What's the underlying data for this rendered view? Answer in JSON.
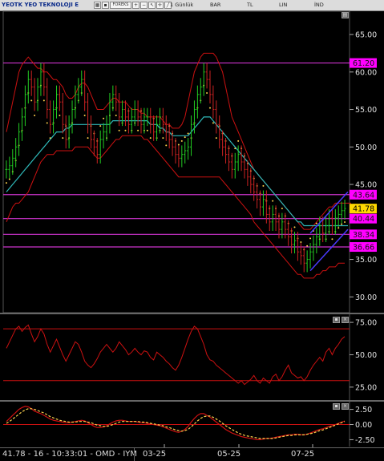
{
  "toolbar": {
    "symbol_title": "YEOTK YEO TEKNOLOJI E",
    "forex_label": "FOREKS",
    "period": "1 Günlük",
    "chart_type": "BAR",
    "currency": "TL",
    "scale": "LIN",
    "indicator_menu": "İND"
  },
  "status": {
    "info": "41.78 - 16 - 10:33:01 - OMD - IYM",
    "dates": [
      "03-25",
      "05-25",
      "07-25"
    ]
  },
  "colors": {
    "bollinger": "#cc1111",
    "ma": "#2fb8b8",
    "sar": "#ffd24d",
    "level": "#cc33cc",
    "up_bar": "#22cc22",
    "down_bar": "#cc2222",
    "rsi": "#cc1111",
    "macd": "#cc1111",
    "signal": "#ffd24d"
  },
  "chart_data": [
    {
      "type": "line",
      "panel": "price",
      "yticks": [
        "65.00",
        "60.00",
        "55.00",
        "50.00",
        "45.00",
        "35.00",
        "30.00"
      ],
      "ylim": [
        28,
        68
      ],
      "levels": [
        {
          "value": 61.2,
          "label": "61.20",
          "color": "#cc33cc"
        },
        {
          "value": 43.64,
          "label": "43.64",
          "color": "#cc33cc"
        },
        {
          "value": 40.44,
          "label": "40.44",
          "color": "#cc33cc"
        },
        {
          "value": 36.66,
          "label": "36.66",
          "color": "#cc33cc"
        },
        {
          "value": 38.34,
          "label": "38.34",
          "color": "#cc33cc"
        }
      ],
      "last_price": {
        "value": 41.78,
        "label": "41.78"
      },
      "closes": [
        47,
        47.5,
        48.5,
        50,
        52,
        54,
        57,
        59,
        58,
        56,
        58,
        60,
        58,
        55,
        53,
        55,
        57,
        56,
        53,
        51,
        53,
        55,
        57,
        58,
        59,
        56,
        53,
        51,
        50,
        49,
        51,
        52,
        53,
        56,
        57,
        56,
        54,
        55,
        54,
        53,
        54,
        55,
        54,
        53,
        54,
        54,
        53,
        52,
        53,
        54,
        53,
        52,
        51,
        50,
        49,
        48.5,
        49,
        49.5,
        50,
        53,
        55,
        57,
        58,
        60,
        59,
        57,
        55,
        53,
        51,
        50,
        49,
        48,
        47,
        48,
        49,
        48,
        47,
        46,
        45,
        44,
        43,
        42,
        43,
        41,
        40,
        41,
        40,
        39,
        40,
        39,
        38,
        37,
        37.5,
        36,
        35.5,
        34.5,
        35,
        36,
        37,
        38,
        39.5,
        38.5,
        39.5,
        40.5,
        39.5,
        40.5,
        41,
        41.5,
        41.78
      ],
      "upper_band": [
        52,
        54,
        56,
        58,
        60,
        61,
        61.5,
        62,
        61.5,
        61,
        60.5,
        60.5,
        60,
        60,
        59.5,
        59,
        59,
        58.5,
        58,
        57,
        56.5,
        56.5,
        57,
        58,
        58.5,
        58.5,
        58,
        57,
        56,
        55,
        55,
        55,
        55.5,
        56,
        56.5,
        56.5,
        56,
        56,
        56,
        55.5,
        55,
        55,
        55,
        54.5,
        54.5,
        54,
        54,
        54,
        54,
        54,
        53.5,
        53,
        53,
        52.5,
        52.5,
        52.5,
        53,
        54,
        56,
        58,
        60,
        61,
        62,
        62.5,
        62.5,
        62.5,
        62.5,
        62,
        61,
        60,
        58,
        56,
        54,
        53,
        52,
        51,
        50,
        49,
        48,
        47,
        46.5,
        46,
        45.5,
        45,
        44.5,
        44,
        43.5,
        43,
        42.5,
        42,
        41.5,
        41,
        40.5,
        40,
        39.5,
        39,
        39,
        39,
        39.5,
        40,
        40.5,
        41,
        41.5,
        42,
        42,
        42.5,
        42.5,
        42.5,
        42.5,
        42.5,
        42.5
      ],
      "lower_band": [
        40,
        41,
        42,
        42.5,
        42.5,
        43,
        43.5,
        44,
        45,
        46,
        47,
        48,
        48.5,
        49,
        49,
        49,
        49.5,
        49.5,
        49.5,
        49.5,
        49.5,
        49.5,
        50,
        50,
        50,
        50,
        50,
        49.5,
        49,
        48.5,
        48.5,
        49,
        49.5,
        50,
        50.5,
        51,
        51,
        51.5,
        51.5,
        51.5,
        51.5,
        51.5,
        51.5,
        51.5,
        51,
        51,
        50.5,
        50,
        49.5,
        49,
        48.5,
        48,
        47.5,
        47,
        46.5,
        46,
        46,
        46,
        46,
        46,
        46,
        46,
        46,
        46,
        46,
        46,
        46,
        46,
        46,
        45.5,
        45,
        44.5,
        44,
        43.5,
        43,
        42.5,
        42,
        41.5,
        41,
        40,
        39.5,
        39,
        38.5,
        38,
        37.5,
        37,
        36.5,
        36,
        35.5,
        35,
        34.5,
        34,
        33.5,
        33,
        33,
        32.5,
        32.5,
        32.5,
        32.5,
        33,
        33,
        33.5,
        33.5,
        34,
        34,
        34,
        34.5,
        34.5,
        34.5
      ],
      "moving_average": [
        44,
        44.5,
        45,
        45.5,
        46,
        46.5,
        47,
        47.5,
        48,
        48.5,
        49,
        49.5,
        50,
        50.5,
        51,
        51.5,
        52,
        52,
        52,
        52.5,
        52.5,
        53,
        53,
        53,
        53,
        53,
        53,
        53,
        53,
        53,
        53,
        53,
        53,
        53,
        53.5,
        53.5,
        53.5,
        53.5,
        53.5,
        53.5,
        53.5,
        53.5,
        53.5,
        53.5,
        53.5,
        53.5,
        53,
        53,
        53,
        52.5,
        52.5,
        52,
        52,
        51.5,
        51.5,
        51.5,
        51.5,
        51.5,
        51.5,
        52,
        52.5,
        53,
        53.5,
        54,
        54,
        54,
        53.5,
        53,
        52.5,
        52,
        51.5,
        51,
        50.5,
        50,
        49.5,
        49,
        48.5,
        48,
        47.5,
        47,
        46.5,
        46,
        45.5,
        45,
        44.5,
        44,
        43.5,
        43,
        42.5,
        42,
        41.5,
        41,
        40.5,
        40,
        40,
        39.5,
        39.5,
        39.5,
        39.5,
        39.5,
        39.5,
        39.5,
        39.5,
        39.5,
        39.5,
        39.5,
        39.5,
        39.5,
        39.5,
        39.5
      ],
      "channel": [
        [
          97,
          38.5,
          109,
          44.0
        ],
        [
          97,
          33.5,
          109,
          39.0
        ]
      ]
    },
    {
      "type": "line",
      "panel": "rsi",
      "yticks": [
        "75.00",
        "50.00",
        "25.00"
      ],
      "ylim": [
        15,
        80
      ],
      "levels": [
        70,
        30
      ],
      "values": [
        55,
        60,
        65,
        70,
        72,
        68,
        71,
        73,
        66,
        60,
        64,
        70,
        66,
        58,
        52,
        57,
        62,
        56,
        50,
        45,
        50,
        55,
        60,
        58,
        52,
        45,
        42,
        40,
        43,
        47,
        52,
        55,
        58,
        55,
        52,
        55,
        60,
        57,
        54,
        50,
        52,
        55,
        52,
        50,
        53,
        52,
        48,
        46,
        52,
        50,
        48,
        45,
        43,
        40,
        38,
        42,
        48,
        55,
        62,
        68,
        72,
        70,
        64,
        58,
        50,
        46,
        45,
        42,
        40,
        38,
        36,
        34,
        32,
        30,
        28,
        30,
        27,
        29,
        31,
        34,
        30,
        28,
        32,
        30,
        28,
        33,
        35,
        30,
        33,
        38,
        42,
        36,
        34,
        32,
        33,
        30,
        33,
        38,
        42,
        45,
        48,
        45,
        52,
        55,
        50,
        55,
        58,
        62,
        64
      ]
    },
    {
      "type": "line",
      "panel": "macd",
      "yticks": [
        "2.50",
        "0.00",
        "-2.50"
      ],
      "ylim": [
        -3.5,
        3.5
      ],
      "macd": [
        0.5,
        1.0,
        1.5,
        2.0,
        2.5,
        2.8,
        3.0,
        2.9,
        2.6,
        2.2,
        2.0,
        1.8,
        1.5,
        1.2,
        0.9,
        0.7,
        0.6,
        0.5,
        0.4,
        0.3,
        0.3,
        0.4,
        0.5,
        0.6,
        0.7,
        0.6,
        0.3,
        0.0,
        -0.3,
        -0.5,
        -0.5,
        -0.4,
        -0.2,
        0.1,
        0.4,
        0.6,
        0.7,
        0.7,
        0.6,
        0.5,
        0.5,
        0.5,
        0.4,
        0.3,
        0.3,
        0.2,
        0.1,
        0.0,
        -0.1,
        -0.2,
        -0.4,
        -0.6,
        -0.8,
        -1.0,
        -1.2,
        -1.3,
        -1.1,
        -0.8,
        -0.3,
        0.4,
        1.0,
        1.5,
        1.8,
        1.8,
        1.5,
        1.2,
        0.8,
        0.4,
        0.0,
        -0.4,
        -0.8,
        -1.1,
        -1.4,
        -1.6,
        -1.8,
        -2.0,
        -2.1,
        -2.2,
        -2.3,
        -2.4,
        -2.5,
        -2.5,
        -2.4,
        -2.3,
        -2.3,
        -2.2,
        -2.1,
        -2.0,
        -1.9,
        -1.8,
        -1.7,
        -1.7,
        -1.6,
        -1.6,
        -1.7,
        -1.7,
        -1.6,
        -1.4,
        -1.2,
        -1.0,
        -0.8,
        -0.7,
        -0.5,
        -0.3,
        -0.2,
        0.0,
        0.2,
        0.4,
        0.6
      ],
      "signal": [
        0.2,
        0.5,
        0.9,
        1.3,
        1.7,
        2.1,
        2.4,
        2.6,
        2.6,
        2.5,
        2.3,
        2.1,
        1.9,
        1.6,
        1.3,
        1.1,
        0.9,
        0.7,
        0.6,
        0.5,
        0.4,
        0.4,
        0.4,
        0.5,
        0.5,
        0.5,
        0.4,
        0.3,
        0.1,
        -0.1,
        -0.2,
        -0.3,
        -0.3,
        -0.2,
        0.0,
        0.2,
        0.4,
        0.5,
        0.5,
        0.5,
        0.5,
        0.5,
        0.5,
        0.4,
        0.4,
        0.3,
        0.2,
        0.1,
        0.0,
        -0.1,
        -0.2,
        -0.4,
        -0.5,
        -0.7,
        -0.9,
        -1.0,
        -1.1,
        -1.0,
        -0.8,
        -0.4,
        0.1,
        0.6,
        1.0,
        1.3,
        1.4,
        1.4,
        1.2,
        0.9,
        0.6,
        0.2,
        -0.2,
        -0.5,
        -0.8,
        -1.1,
        -1.4,
        -1.6,
        -1.8,
        -1.9,
        -2.0,
        -2.1,
        -2.2,
        -2.3,
        -2.3,
        -2.3,
        -2.3,
        -2.3,
        -2.2,
        -2.1,
        -2.0,
        -1.9,
        -1.8,
        -1.8,
        -1.7,
        -1.7,
        -1.7,
        -1.7,
        -1.6,
        -1.5,
        -1.4,
        -1.2,
        -1.0,
        -0.9,
        -0.7,
        -0.5,
        -0.3,
        -0.1,
        0.1,
        0.3,
        0.5
      ]
    }
  ]
}
